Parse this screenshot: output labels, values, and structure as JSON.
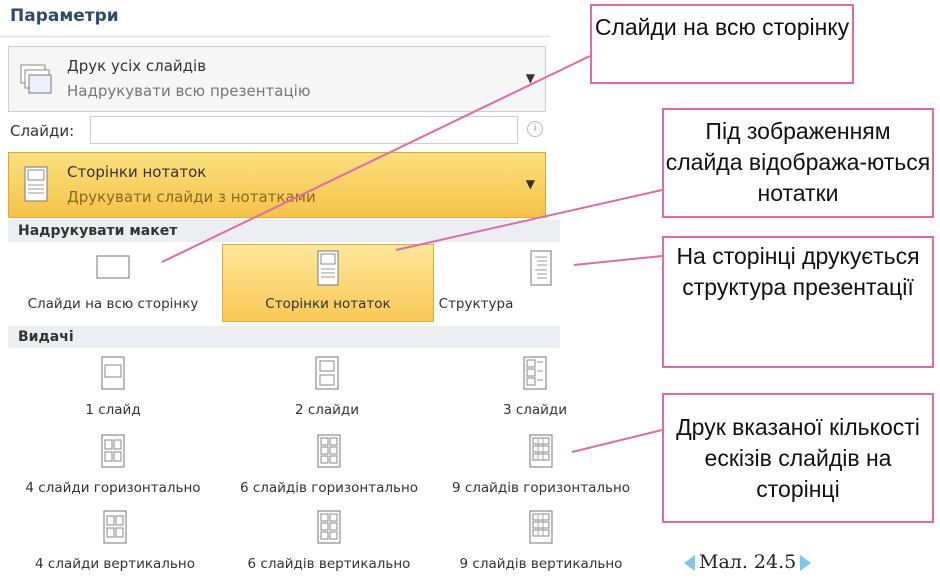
{
  "panel": {
    "title": "Параметри",
    "print_dropdown": {
      "title": "Друк усіх слайдів",
      "subtitle": "Надрукувати всю презентацію"
    },
    "slides_label": "Слайди:",
    "slides_value": "",
    "layout_dropdown": {
      "title": "Сторінки нотаток",
      "subtitle": "Друкувати слайди з нотатками"
    },
    "section_layout": "Надрукувати макет",
    "layout_items": [
      "Слайди на всю сторінку",
      "Сторінки нотаток",
      "Структура"
    ],
    "section_handouts": "Видачі",
    "handouts": [
      "1 слайд",
      "2 слайди",
      "3 слайди",
      "4 слайди горизонтально",
      "6 слайдів горизонтально",
      "9 слайдів горизонтально",
      "4 слайди вертикально",
      "6 слайдів вертикально",
      "9 слайдів вертикально"
    ]
  },
  "callouts": {
    "c1": "Слайди на всю сторінку",
    "c2": "Під зображенням слайда відобража-ються нотатки",
    "c3": "На сторінці друкується структура презентації",
    "c4": "Друк вказаної кількості ескізів слайдів на сторінці"
  },
  "caption": "Мал. 24.5",
  "colors": {
    "accent": "#f8c857",
    "callout_border": "#e36aa7",
    "arrow": "#7fc6e8"
  }
}
